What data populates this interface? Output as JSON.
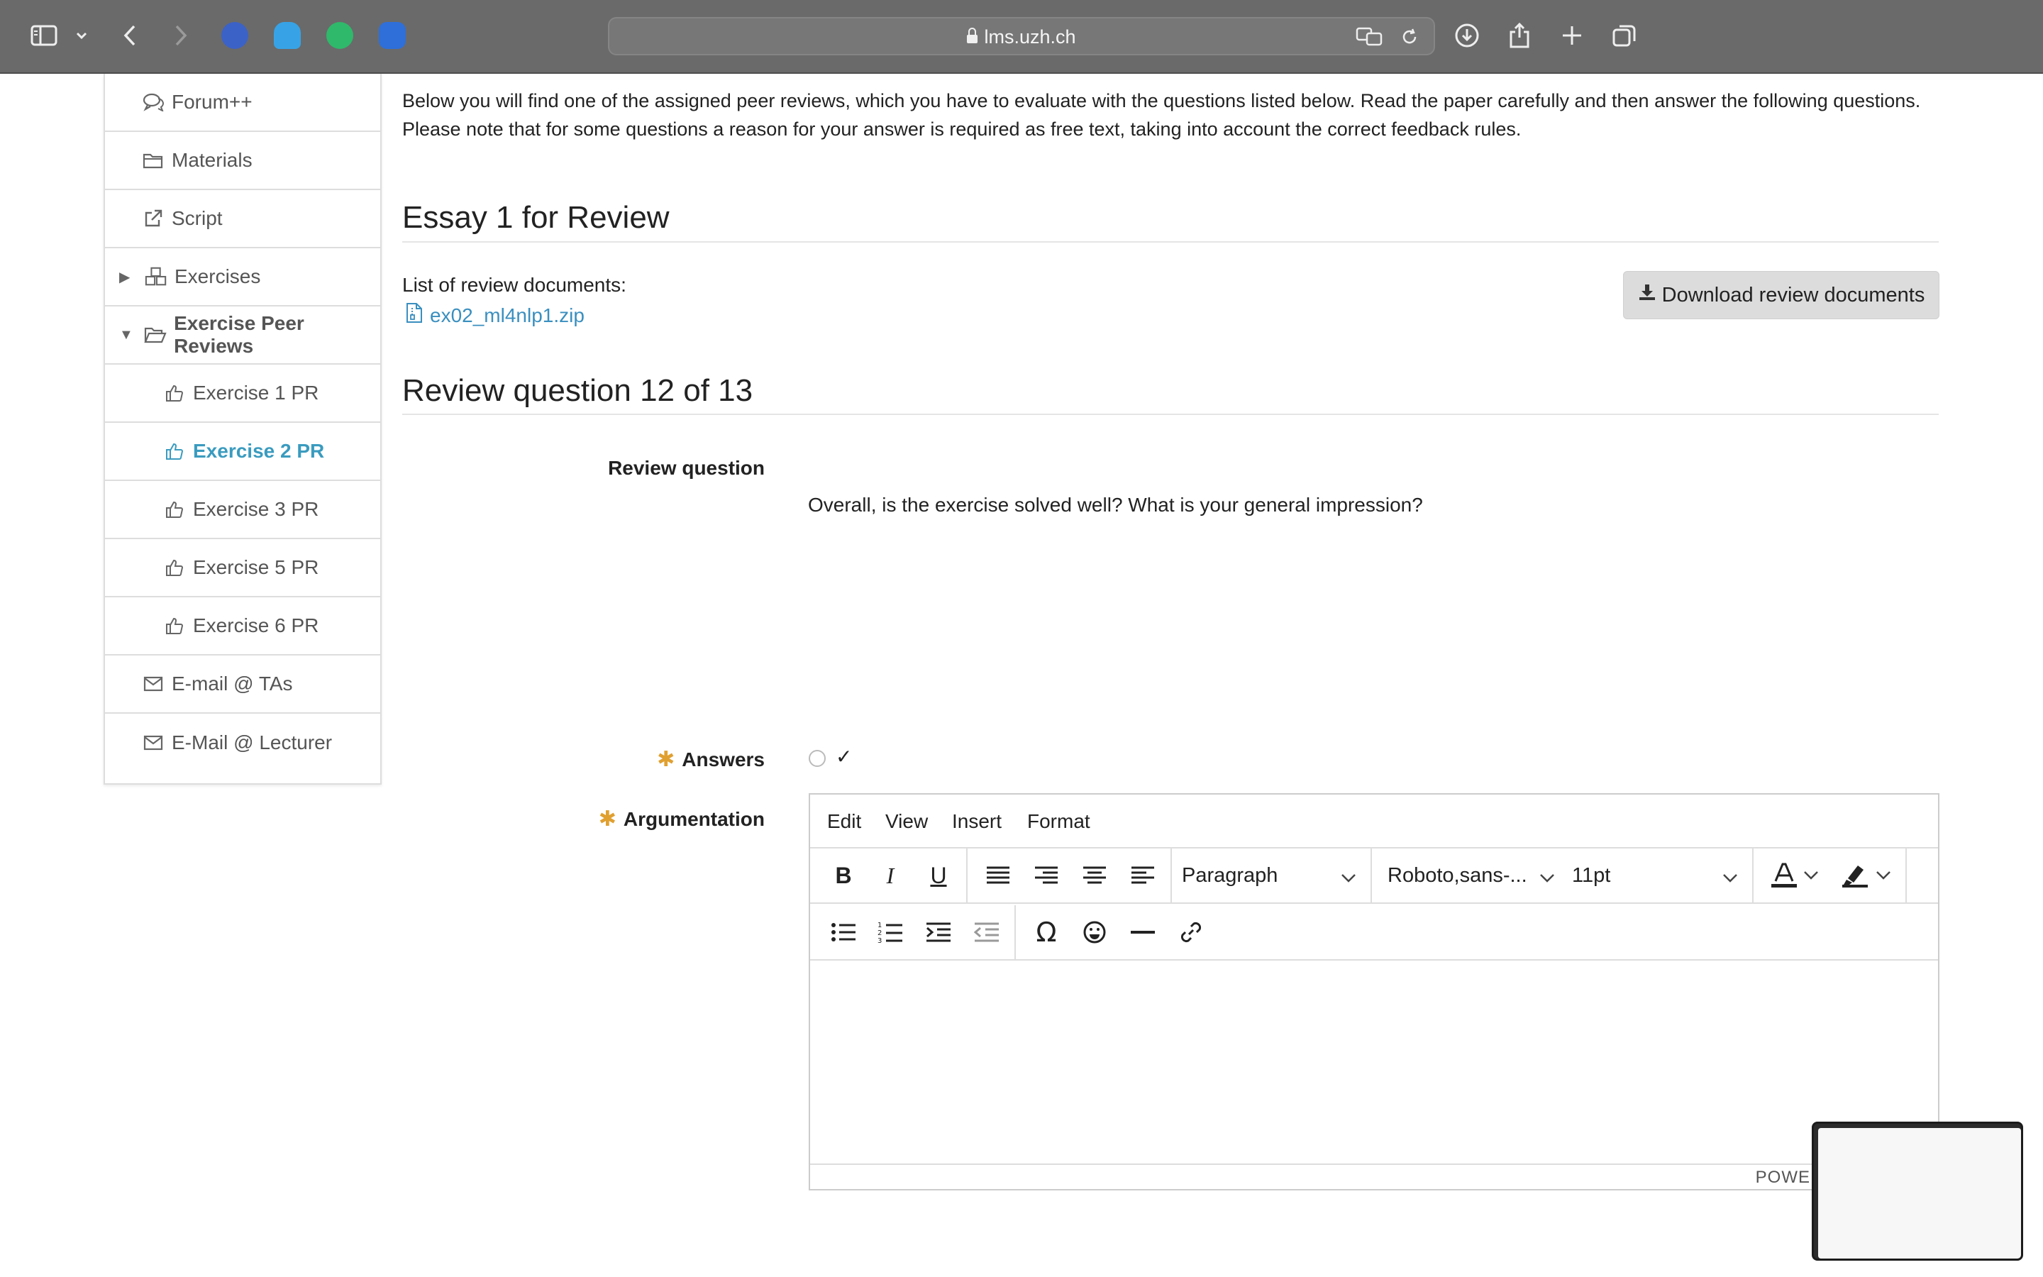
{
  "browser": {
    "url": "lms.uzh.ch",
    "extension_icons": [
      "shield-extension-icon",
      "ghostery-icon",
      "grammarly-icon",
      "vpn-extension-icon"
    ]
  },
  "sidebar": {
    "items": [
      {
        "label": "Forum++",
        "icon": "chat-icon"
      },
      {
        "label": "Materials",
        "icon": "folder-icon"
      },
      {
        "label": "Script",
        "icon": "external-link-icon"
      },
      {
        "label": "Exercises",
        "icon": "cubes-icon"
      },
      {
        "label": "Exercise Peer Reviews",
        "icon": "folder-open-icon"
      },
      {
        "label": "Exercise 1 PR",
        "icon": "thumbs-up-icon"
      },
      {
        "label": "Exercise 2 PR",
        "icon": "thumbs-up-icon",
        "active": true
      },
      {
        "label": "Exercise 3 PR",
        "icon": "thumbs-up-icon"
      },
      {
        "label": "Exercise 5 PR",
        "icon": "thumbs-up-icon"
      },
      {
        "label": "Exercise 6 PR",
        "icon": "thumbs-up-icon"
      },
      {
        "label": "E-mail @ TAs",
        "icon": "envelope-icon"
      },
      {
        "label": "E-Mail @ Lecturer",
        "icon": "envelope-icon"
      }
    ]
  },
  "main": {
    "intro": "Below you will find one of the assigned peer reviews, which you have to evaluate with the questions listed below. Read the paper carefully and then answer the following questions. Please note that for some questions a reason for your answer is required as free text, taking into account the correct feedback rules.",
    "essay_title": "Essay 1 for Review",
    "docs_label": "List of review documents:",
    "doc_file": "ex02_ml4nlp1.zip",
    "download_label": "Download review documents",
    "question_heading": "Review question 12 of 13",
    "review_question_label": "Review question",
    "review_question_text": "Overall, is the exercise solved well? What is your general impression?",
    "answers_label": "Answers",
    "answer_option": "✓",
    "argumentation_label": "Argumentation",
    "required_marker": "✱"
  },
  "editor": {
    "menu": [
      "Edit",
      "View",
      "Insert",
      "Format"
    ],
    "block_format": "Paragraph",
    "font_family": "Roboto,sans-...",
    "font_size": "11pt",
    "bold": "B",
    "italic": "I",
    "underline": "U",
    "special_char": "Ω",
    "powered_by": "POWE"
  }
}
